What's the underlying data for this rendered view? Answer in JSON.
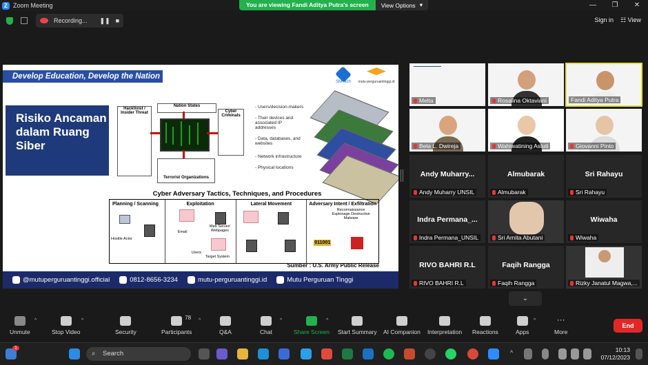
{
  "window": {
    "title": "Zoom Meeting",
    "viewing_text": "You are viewing Fandi Aditya Putra's screen",
    "view_options": "View Options"
  },
  "topbar": {
    "recording": "Recording...",
    "sign_in": "Sign in",
    "view": "View"
  },
  "slide": {
    "banner": "Develop Education, Develop the Nation",
    "logo_smtech": "SMTech",
    "logo_mutu": "mutu-perguruantinggi.id",
    "title": "Risiko Ancaman dalam Ruang Siber",
    "actors": {
      "hacktivist": "Hacktivist / Insider Threat",
      "nation": "Nation States",
      "criminals": "Cyber Criminals",
      "terrorist": "Terrorist Organizations"
    },
    "layers": [
      "- Users/decision-makers",
      "- Their devices and associated IP addresses",
      "- Data, databases, and websites",
      "- Network infrastructure",
      "- Physical locations"
    ],
    "tactics_title": "Cyber Adversary Tactics, Techniques, and Procedures",
    "tactics": [
      {
        "head": "Planning / Scanning",
        "sub": "Hostile Actor"
      },
      {
        "head": "Exploitation",
        "sub": "Web Server/ Webpages"
      },
      {
        "head": "Lateral Movement",
        "sub": ""
      },
      {
        "head": "Adversary Intent / Exfiltration",
        "sub": "Reconnaissance Espionage Destructive Malware"
      }
    ],
    "tactic_labels": {
      "email": "Email",
      "users": "Users",
      "target": "Target System",
      "binary": "011001"
    },
    "source": "Sumber : U.S. Army Public Release",
    "footer": [
      "@mutuperguruantinggi.official",
      "0812-8656-3234",
      "mutu-perguruantinggi.id",
      "Mutu Perguruan Tinggi"
    ]
  },
  "participants": [
    {
      "name": "Melta",
      "big": "",
      "video": true
    },
    {
      "name": "Rosalina Oktaviani",
      "big": "",
      "video": true
    },
    {
      "name": "Fandi Aditya Putra",
      "big": "",
      "video": true,
      "active": true
    },
    {
      "name": "Bela L. Dwireja",
      "big": "",
      "video": true
    },
    {
      "name": "Wahiwatining Astuti",
      "big": "",
      "video": true
    },
    {
      "name": "Giovanni Pinto",
      "big": "",
      "video": true
    },
    {
      "name": "Andy Muharry UNSIL",
      "big": "Andy Muharry...",
      "video": false
    },
    {
      "name": "Almubarak",
      "big": "Almubarak",
      "video": false
    },
    {
      "name": "Sri Rahayu",
      "big": "Sri Rahayu",
      "video": false
    },
    {
      "name": "Indra Permana_UNSIL",
      "big": "Indra Permana_...",
      "video": false
    },
    {
      "name": "Sri Arnita Abutani",
      "big": "",
      "video": true
    },
    {
      "name": "Wiwaha",
      "big": "Wiwaha",
      "video": false
    },
    {
      "name": "RIVO BAHRI R.L",
      "big": "RIVO BAHRI R.L",
      "video": false
    },
    {
      "name": "Faqih Rangga",
      "big": "Faqih Rangga",
      "video": false
    },
    {
      "name": "Rizky Janatul Magwa,...",
      "big": "",
      "video": true
    }
  ],
  "toolbar": {
    "unmute": "Unmute",
    "stop_video": "Stop Video",
    "security": "Security",
    "participants": "Participants",
    "participants_count": "78",
    "qa": "Q&A",
    "chat": "Chat",
    "share_screen": "Share Screen",
    "start_summary": "Start Summary",
    "ai_companion": "AI Companion",
    "interpretation": "Interpretation",
    "reactions": "Reactions",
    "apps": "Apps",
    "more": "More",
    "end": "End"
  },
  "taskbar": {
    "search": "Search",
    "time": "10:13",
    "date": "07/12/2023",
    "notif": "1"
  }
}
